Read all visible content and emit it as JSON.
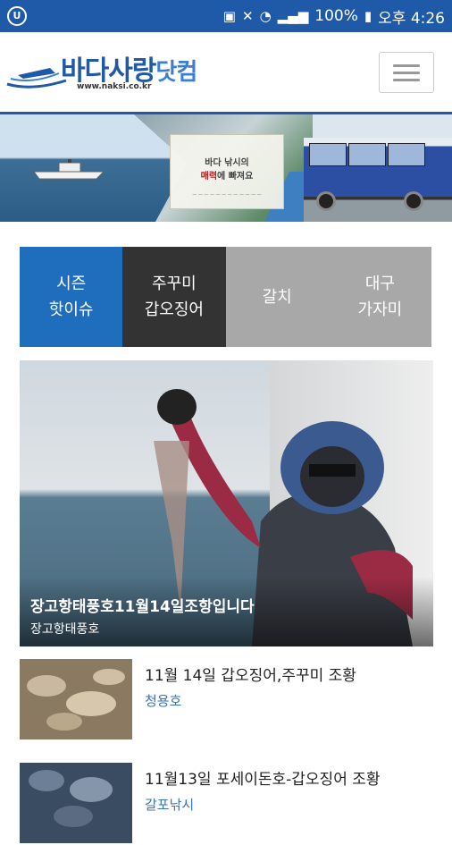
{
  "status_bar": {
    "battery": "100%",
    "time": "오후 4:26",
    "icons": [
      "nfc-icon",
      "mute-icon",
      "wifi-icon",
      "signal-icon",
      "battery-icon"
    ]
  },
  "header": {
    "logo_text": "바다사랑",
    "logo_suffix": "닷컴",
    "logo_url": "www.naksi.co.kr",
    "menu_icon": "hamburger-menu-icon"
  },
  "banner": {
    "line1_prefix": "바다 낚시의",
    "line2_accent": "매력",
    "line2_rest": "에 빠져요"
  },
  "tabs": [
    {
      "label": "시즌\n핫이슈",
      "active": true
    },
    {
      "label": "주꾸미\n갑오징어",
      "active": false
    },
    {
      "label": "갈치",
      "active": false
    },
    {
      "label": "대구\n가자미",
      "active": false
    }
  ],
  "featured": {
    "title": "장고항태풍호11월14일조항입니다",
    "subtitle": "장고항태풍호"
  },
  "posts": [
    {
      "title": "11월 14일 갑오징어,주꾸미 조황",
      "author": "청용호"
    },
    {
      "title": "11월13일 포세이돈호-갑오징어 조황",
      "author": "갈포낚시"
    }
  ],
  "colors": {
    "brand_blue": "#1f5aa8",
    "tab_active": "#1f6dbd",
    "tab_dark": "#333333",
    "tab_gray": "#a8a8a8",
    "author_link": "#3a73b8"
  }
}
